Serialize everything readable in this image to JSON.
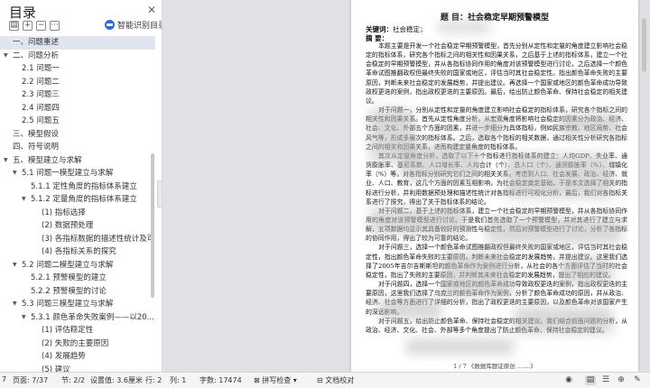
{
  "toc": {
    "title": "目录",
    "smart_toc_label": "智能识别目录",
    "items": [
      {
        "label": "一、问题重述",
        "level": 0,
        "arrow": false,
        "selected": true
      },
      {
        "label": "二、问题分析",
        "level": 0,
        "arrow": true
      },
      {
        "label": "2.1 问题一",
        "level": 1,
        "arrow": false
      },
      {
        "label": "2.2 问题二",
        "level": 1,
        "arrow": false
      },
      {
        "label": "2.3 问题三",
        "level": 1,
        "arrow": false
      },
      {
        "label": "2.4 问题四",
        "level": 1,
        "arrow": false
      },
      {
        "label": "2.5 问题五",
        "level": 1,
        "arrow": false
      },
      {
        "label": "三、模型假设",
        "level": 0,
        "arrow": false
      },
      {
        "label": "四、符号说明",
        "level": 0,
        "arrow": false
      },
      {
        "label": "五、模型建立与求解",
        "level": 0,
        "arrow": true
      },
      {
        "label": "5.1 问题一模型建立与求解",
        "level": 1,
        "arrow": true
      },
      {
        "label": "5.1.1 定性角度的指标体系建立",
        "level": 2,
        "arrow": false
      },
      {
        "label": "5.1.2 定量角度的指标体系建立",
        "level": 2,
        "arrow": true
      },
      {
        "label": "(1) 指标选择",
        "level": 3,
        "arrow": false
      },
      {
        "label": "(2) 数据预处理",
        "level": 3,
        "arrow": false
      },
      {
        "label": "(3) 各指标数据的描述性统计及可...",
        "level": 3,
        "arrow": false
      },
      {
        "label": "(4) 各指标关系的探究",
        "level": 3,
        "arrow": false
      },
      {
        "label": "5.2 问题二模型建立与求解",
        "level": 1,
        "arrow": true
      },
      {
        "label": "5.2.1 预警模型的建立",
        "level": 2,
        "arrow": false
      },
      {
        "label": "5.2.2 预警模型的讨论",
        "level": 2,
        "arrow": false
      },
      {
        "label": "5.3 问题三模型建立与求解",
        "level": 1,
        "arrow": true
      },
      {
        "label": "5.3.1 颜色革命失败案例——以20...",
        "level": 2,
        "arrow": true
      },
      {
        "label": "(1) 评估稳定性",
        "level": 3,
        "arrow": false
      },
      {
        "label": "(2) 失败的主要原因",
        "level": 3,
        "arrow": false
      },
      {
        "label": "(4) 发展趋势",
        "level": 3,
        "arrow": false
      },
      {
        "label": "(5) 建议",
        "level": 3,
        "arrow": false
      },
      {
        "label": "5.4 问题四模型建立与求解",
        "level": 1,
        "arrow": true
      },
      {
        "label": "5.4.1 颜色革命预警模型...",
        "level": 2,
        "arrow": false
      }
    ]
  },
  "doc": {
    "title": "题 目：社会稳定早期预警模型",
    "keywords_label": "关键词：",
    "keywords_value": "社会稳定；",
    "abstract_label": "摘 要：",
    "paragraphs": [
      "本题主要是开发一个社会稳定早期预警模型，首先分别从定性和定量的角度建立影响社会稳定的指标体系，研究各个指标之间的相关性和因果关系，之后基于上述的指标体系，建立一个社会稳定的早期预警模型，并从各指标协同作用的角度对该预警模型进行讨论，之后选择一个颜色革命试图推翻政权但最终失败的国家或地区，评估当时其社会稳定性。指出颜色革命失败的主要原因，判断未来社会稳定的发展趋势，并提出建议。再选择一个国家或地区的颜色革命成功导致政权更迭的案例，指出政权更迭的主要原因。最后，给出防止颜色革命、保持社会稳定的相关建议。",
      "对于问题一，分别从定性和定量的角度建立影响社会稳定的指标体系，研究各个指标之间的相关性和因果关系。首先从定性角度分析，从宏观角度将影响社会稳定的因素分为政治、经济、社会、文化、外部五个方面的因素，并进一步细分为具体指标，例如民族宗教、地区局势、社会风气等，形成多层次的指标体系。之后，选取各个指标的相关数据，通过相关性分析研究各指标之间的相关和因果关系，进而构建定量角度的指标体系。",
      "其次从定量角度分析，选取了以下十个指标进行指标体系的建立：人均GDP、失业率、通货膨胀率、基尼系数、人口增长率、人均合计（个）、总人口（个）、通货膨胀率（%）、城镇化率（%）等，对各指标分别研究它们之间的相关关系。考虑到人口、社会发展、政治、经济、就业、人口、教育，这几个方面的因素互相影响，为社会稳定奠定基础，于是本文选择了相关的指标进行分析，并利用数据预处理和描述性统计对各指标进行可视化分析，最后，我们对各指标关系进行了探究，得出了关于指标体系的结论。",
      "对于问题二，基于上述的指标体系，建立一个社会稳定的早期预警模型，并从各指标协同作用的角度对该预警模型进行讨论。于是我们首先选取了一个预警模型，并对其进行了建立与求解，五项数据均显示其具备较好的预测性与稳定性，然后对预警模型进行了讨论，分析了各指标的协同作用，得出了较为可靠的结论。",
      "对于问题三，选择一个颜色革命试图推翻政权但最终失败的国家或地区，评估当时其社会稳定性，指出颜色革命失败的主要原因，判断未来社会稳定的发展趋势，并提出建议。这里我们选择了2005年吉尔吉斯斯坦的颜色革命作为案例进行分析，从社会的各个方面评估了当时的社会稳定性，指出了失败的主要原因，并判断其未来社会稳定的发展趋势，提出了相应的建议。",
      "对于问题四，选择一个国家或地区的颜色革命成功导致政权更迭的案例，指出政权更迭的主要原因，这里我们选择了乌克兰的颜色革命作为案例，分析了颜色革命成功的原因，并从政治、经济、社会等方面进行了详细的分析，指出了政权更迭的主要原因，以及颜色革命对该国家产生的深远影响。",
      "对于问题五，给出防止颜色革命、保持社会稳定的相关建议。我们结合前面问题的分析，从政治、经济、文化、社会、外部等多个角度提出了防止颜色革命、保持社会稳定的建议。"
    ],
    "footnote": "1 / 7 《数据库题证原创 .......》"
  },
  "status": {
    "page_prefix": "7",
    "page": "页面: 7/37",
    "section": "节: 2/2",
    "setting": "设置值: 3.6厘米",
    "row": "行: 2",
    "col": "列: 1",
    "wordcount": "字数: 17474",
    "spellcheck": "拼写检查",
    "compare": "文档校对"
  },
  "colors": {
    "accent": "#2f6bd8",
    "selected_bg": "#dfe6f1"
  }
}
